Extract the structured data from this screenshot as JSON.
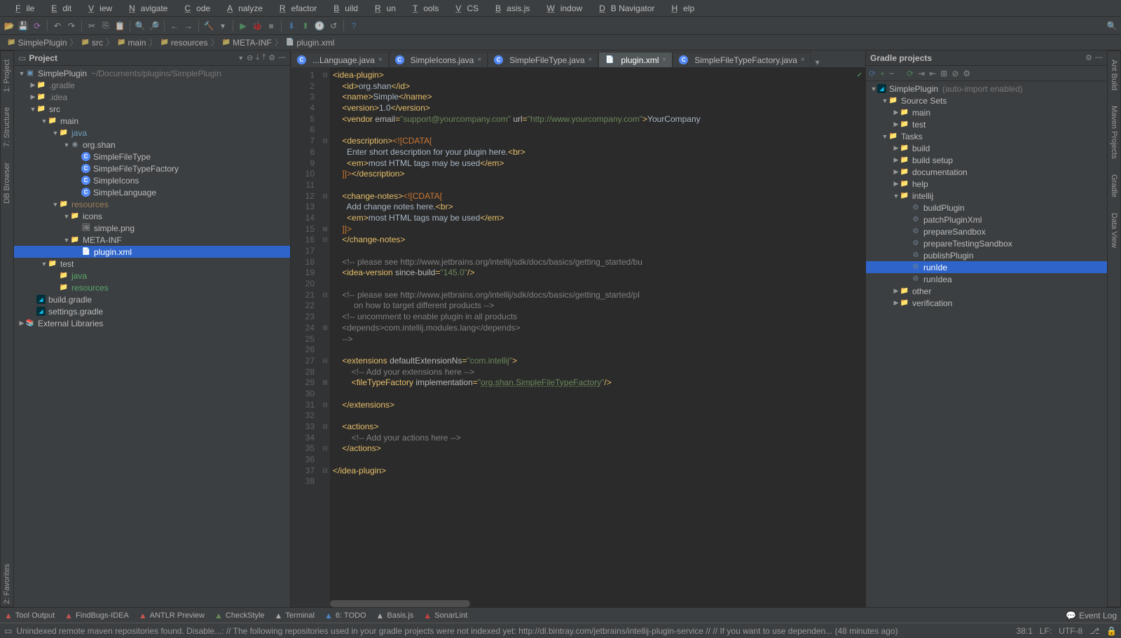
{
  "menu": [
    "File",
    "Edit",
    "View",
    "Navigate",
    "Code",
    "Analyze",
    "Refactor",
    "Build",
    "Run",
    "Tools",
    "VCS",
    "Basis.js",
    "Window",
    "DB Navigator",
    "Help"
  ],
  "breadcrumb": [
    {
      "icon": "folder",
      "label": "SimplePlugin"
    },
    {
      "icon": "folder",
      "label": "src"
    },
    {
      "icon": "folder",
      "label": "main"
    },
    {
      "icon": "folder",
      "label": "resources"
    },
    {
      "icon": "folder",
      "label": "META-INF"
    },
    {
      "icon": "xml",
      "label": "plugin.xml"
    }
  ],
  "leftGutter": [
    {
      "n": "project-tool",
      "label": "1: Project"
    },
    {
      "n": "structure-tool",
      "label": "7: Structure"
    },
    {
      "n": "db-browser-tool",
      "label": "DB Browser"
    }
  ],
  "leftGutterBottom": [
    {
      "n": "favorites-tool",
      "label": "2: Favorites"
    }
  ],
  "rightGutter": [
    {
      "n": "ant-build-tool",
      "label": "Ant Build"
    },
    {
      "n": "maven-tool",
      "label": "Maven Projects"
    },
    {
      "n": "gradle-tool",
      "label": "Gradle"
    },
    {
      "n": "data-view-tool",
      "label": "Data View"
    }
  ],
  "projectPanel": {
    "title": "Project"
  },
  "tree": [
    {
      "d": 0,
      "a": "v",
      "i": "module",
      "t": "SimplePlugin",
      "suffix": "~/Documents/plugins/SimplePlugin"
    },
    {
      "d": 1,
      "a": ">",
      "i": "folder",
      "t": ".gradle",
      "dim": true
    },
    {
      "d": 1,
      "a": ">",
      "i": "folder",
      "t": ".idea",
      "dim": true
    },
    {
      "d": 1,
      "a": "v",
      "i": "folder",
      "t": "src"
    },
    {
      "d": 2,
      "a": "v",
      "i": "folder",
      "t": "main"
    },
    {
      "d": 3,
      "a": "v",
      "i": "folder",
      "t": "java",
      "src": true
    },
    {
      "d": 4,
      "a": "v",
      "i": "pkg",
      "t": "org.shan"
    },
    {
      "d": 5,
      "a": "",
      "i": "class",
      "t": "SimpleFileType"
    },
    {
      "d": 5,
      "a": "",
      "i": "class",
      "t": "SimpleFileTypeFactory"
    },
    {
      "d": 5,
      "a": "",
      "i": "class",
      "t": "SimpleIcons"
    },
    {
      "d": 5,
      "a": "",
      "i": "class",
      "t": "SimpleLanguage"
    },
    {
      "d": 3,
      "a": "v",
      "i": "folder",
      "t": "resources",
      "res": true
    },
    {
      "d": 4,
      "a": "v",
      "i": "folder",
      "t": "icons"
    },
    {
      "d": 5,
      "a": "",
      "i": "img",
      "t": "simple.png"
    },
    {
      "d": 4,
      "a": "v",
      "i": "folder",
      "t": "META-INF"
    },
    {
      "d": 5,
      "a": "",
      "i": "xml",
      "t": "plugin.xml",
      "sel": true
    },
    {
      "d": 2,
      "a": "v",
      "i": "folder",
      "t": "test"
    },
    {
      "d": 3,
      "a": "",
      "i": "folder",
      "t": "java",
      "tst": true
    },
    {
      "d": 3,
      "a": "",
      "i": "folder",
      "t": "resources",
      "tres": true
    },
    {
      "d": 1,
      "a": "",
      "i": "gradle",
      "t": "build.gradle"
    },
    {
      "d": 1,
      "a": "",
      "i": "gradle",
      "t": "settings.gradle"
    },
    {
      "d": 0,
      "a": ">",
      "i": "lib",
      "t": "External Libraries"
    }
  ],
  "tabs": [
    {
      "i": "class",
      "t": "...Language.java",
      "trunc": true
    },
    {
      "i": "class",
      "t": "SimpleIcons.java"
    },
    {
      "i": "class",
      "t": "SimpleFileType.java"
    },
    {
      "i": "xml",
      "t": "plugin.xml",
      "active": true
    },
    {
      "i": "class",
      "t": "SimpleFileTypeFactory.java"
    }
  ],
  "lines": 38,
  "folds": {
    "1": "-",
    "7": "-",
    "12": "-",
    "15": "+",
    "16": "-",
    "21": "-",
    "24": "+",
    "27": "-",
    "29": "+",
    "31": "-",
    "33": "-",
    "35": "-",
    "37": "-"
  },
  "code": [
    [
      [
        "tag",
        "<idea-plugin>"
      ]
    ],
    [
      [
        "txt",
        "    "
      ],
      [
        "tag",
        "<id>"
      ],
      [
        "txt",
        "org.shan"
      ],
      [
        "tag",
        "</id>"
      ]
    ],
    [
      [
        "txt",
        "    "
      ],
      [
        "tag",
        "<name>"
      ],
      [
        "txt",
        "Simple"
      ],
      [
        "tag",
        "</name>"
      ]
    ],
    [
      [
        "txt",
        "    "
      ],
      [
        "tag",
        "<version>"
      ],
      [
        "txt",
        "1.0"
      ],
      [
        "tag",
        "</version>"
      ]
    ],
    [
      [
        "txt",
        "    "
      ],
      [
        "tag",
        "<vendor "
      ],
      [
        "attr",
        "email"
      ],
      [
        "tag",
        "="
      ],
      [
        "str",
        "\"support@yourcompany.com\""
      ],
      [
        "tag",
        " "
      ],
      [
        "attr",
        "url"
      ],
      [
        "tag",
        "="
      ],
      [
        "str",
        "\"http://www.yourcompany.com\""
      ],
      [
        "tag",
        ">"
      ],
      [
        "txt",
        "YourCompany"
      ]
    ],
    [],
    [
      [
        "txt",
        "    "
      ],
      [
        "tag",
        "<description>"
      ],
      [
        "cdata",
        "<![CDATA["
      ]
    ],
    [
      [
        "txt",
        "      Enter short description for your plugin here."
      ],
      [
        "tag",
        "<br>"
      ]
    ],
    [
      [
        "txt",
        "      "
      ],
      [
        "tag",
        "<em>"
      ],
      [
        "txt",
        "most HTML tags may be used"
      ],
      [
        "tag",
        "</em>"
      ]
    ],
    [
      [
        "cdata",
        "    ]]>"
      ],
      [
        "tag",
        "</description>"
      ]
    ],
    [],
    [
      [
        "txt",
        "    "
      ],
      [
        "tag",
        "<change-notes>"
      ],
      [
        "cdata",
        "<![CDATA["
      ]
    ],
    [
      [
        "txt",
        "      Add change notes here."
      ],
      [
        "tag",
        "<br>"
      ]
    ],
    [
      [
        "txt",
        "      "
      ],
      [
        "tag",
        "<em>"
      ],
      [
        "txt",
        "most HTML tags may be used"
      ],
      [
        "tag",
        "</em>"
      ]
    ],
    [
      [
        "cdata",
        "    ]]>"
      ]
    ],
    [
      [
        "txt",
        "    "
      ],
      [
        "tag",
        "</change-notes>"
      ]
    ],
    [],
    [
      [
        "txt",
        "    "
      ],
      [
        "com",
        "<!-- please see http://www.jetbrains.org/intellij/sdk/docs/basics/getting_started/bu"
      ]
    ],
    [
      [
        "txt",
        "    "
      ],
      [
        "tag",
        "<idea-version "
      ],
      [
        "attr",
        "since-build"
      ],
      [
        "tag",
        "="
      ],
      [
        "str",
        "\"145.0\""
      ],
      [
        "tag",
        "/>"
      ]
    ],
    [],
    [
      [
        "txt",
        "    "
      ],
      [
        "com",
        "<!-- please see http://www.jetbrains.org/intellij/sdk/docs/basics/getting_started/pl"
      ]
    ],
    [
      [
        "txt",
        "         "
      ],
      [
        "com",
        "on how to target different products -->"
      ]
    ],
    [
      [
        "txt",
        "    "
      ],
      [
        "com",
        "<!-- uncomment to enable plugin in all products"
      ]
    ],
    [
      [
        "txt",
        "    "
      ],
      [
        "com",
        "<depends>com.intellij.modules.lang</depends>"
      ]
    ],
    [
      [
        "txt",
        "    "
      ],
      [
        "com",
        "-->"
      ]
    ],
    [],
    [
      [
        "txt",
        "    "
      ],
      [
        "tag",
        "<extensions "
      ],
      [
        "attr",
        "defaultExtensionNs"
      ],
      [
        "tag",
        "="
      ],
      [
        "str",
        "\"com.intellij\""
      ],
      [
        "tag",
        ">"
      ]
    ],
    [
      [
        "txt",
        "        "
      ],
      [
        "com",
        "<!-- Add your extensions here -->"
      ]
    ],
    [
      [
        "txt",
        "        "
      ],
      [
        "tag",
        "<fileTypeFactory "
      ],
      [
        "attr",
        "implementation"
      ],
      [
        "tag",
        "="
      ],
      [
        "str",
        "\""
      ],
      [
        "stru",
        "org.shan.SimpleFileTypeFactory"
      ],
      [
        "str",
        "\""
      ],
      [
        "tag",
        "/>"
      ]
    ],
    [],
    [
      [
        "txt",
        "    "
      ],
      [
        "tag",
        "</extensions>"
      ]
    ],
    [],
    [
      [
        "txt",
        "    "
      ],
      [
        "tag",
        "<actions>"
      ]
    ],
    [
      [
        "txt",
        "        "
      ],
      [
        "com",
        "<!-- Add your actions here -->"
      ]
    ],
    [
      [
        "txt",
        "    "
      ],
      [
        "tag",
        "</actions>"
      ]
    ],
    [],
    [
      [
        "tag",
        "</idea-plugin>"
      ]
    ],
    []
  ],
  "gradlePanel": {
    "title": "Gradle projects"
  },
  "gtree": [
    {
      "d": 0,
      "a": "v",
      "i": "gradle",
      "t": "SimplePlugin",
      "suffix": "(auto-import enabled)"
    },
    {
      "d": 1,
      "a": "v",
      "i": "folder",
      "t": "Source Sets"
    },
    {
      "d": 2,
      "a": ">",
      "i": "folder",
      "t": "main"
    },
    {
      "d": 2,
      "a": ">",
      "i": "folder",
      "t": "test"
    },
    {
      "d": 1,
      "a": "v",
      "i": "folder",
      "t": "Tasks"
    },
    {
      "d": 2,
      "a": ">",
      "i": "tfolder",
      "t": "build"
    },
    {
      "d": 2,
      "a": ">",
      "i": "tfolder",
      "t": "build setup"
    },
    {
      "d": 2,
      "a": ">",
      "i": "tfolder",
      "t": "documentation"
    },
    {
      "d": 2,
      "a": ">",
      "i": "tfolder",
      "t": "help"
    },
    {
      "d": 2,
      "a": "v",
      "i": "tfolder",
      "t": "intellij"
    },
    {
      "d": 3,
      "a": "",
      "i": "gear",
      "t": "buildPlugin"
    },
    {
      "d": 3,
      "a": "",
      "i": "gear",
      "t": "patchPluginXml"
    },
    {
      "d": 3,
      "a": "",
      "i": "gear",
      "t": "prepareSandbox"
    },
    {
      "d": 3,
      "a": "",
      "i": "gear",
      "t": "prepareTestingSandbox"
    },
    {
      "d": 3,
      "a": "",
      "i": "gear",
      "t": "publishPlugin"
    },
    {
      "d": 3,
      "a": "",
      "i": "gear",
      "t": "runIde",
      "sel": true
    },
    {
      "d": 3,
      "a": "",
      "i": "gear",
      "t": "runIdea"
    },
    {
      "d": 2,
      "a": ">",
      "i": "tfolder",
      "t": "other"
    },
    {
      "d": 2,
      "a": ">",
      "i": "tfolder",
      "t": "verification"
    }
  ],
  "bottom": [
    {
      "i": "warn",
      "c": "#c75450",
      "t": "Tool Output"
    },
    {
      "i": "bug",
      "c": "#c75450",
      "t": "FindBugs-IDEA"
    },
    {
      "i": "warn",
      "c": "#c75450",
      "t": "ANTLR Preview"
    },
    {
      "i": "check",
      "c": "#6a8759",
      "t": "CheckStyle"
    },
    {
      "i": "term",
      "c": "#aaa",
      "t": "Terminal"
    },
    {
      "i": "todo",
      "c": "#4a88c7",
      "t": "6: TODO"
    },
    {
      "i": "dot",
      "c": "#aaa",
      "t": "Basis.js"
    },
    {
      "i": "sonar",
      "c": "#cb4040",
      "t": "SonarLint"
    }
  ],
  "eventLog": "Event Log",
  "status": {
    "msg": "Unindexed remote maven repositories found. Disable...: // The following repositories used in your gradle projects were not indexed yet: http://dl.bintray.com/jetbrains/intellij-plugin-service // // If you want to use dependen... (48 minutes ago)",
    "pos": "38:1",
    "lf": "LF:",
    "enc": "UTF-8"
  }
}
